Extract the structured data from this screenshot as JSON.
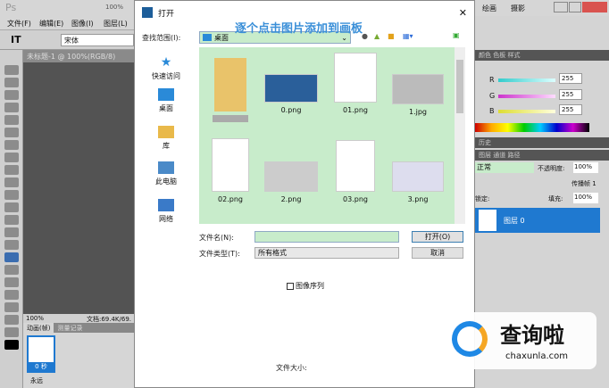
{
  "app": {
    "logo": "Ps",
    "zoom": "100%",
    "menus": [
      "文件(F)",
      "编辑(E)",
      "图像(I)",
      "图层(L)"
    ],
    "right_menus": [
      "绘画",
      "摄影"
    ],
    "font": "宋体",
    "doc_tab": "未标题-1 @ 100%(RGB/8)",
    "status_zoom": "100%",
    "status_doc": "文档:69.4K/69.",
    "anim_tabs": [
      "动画(帧)",
      "测量记录"
    ],
    "frame_time": "0 秒",
    "loop": "永远"
  },
  "dialog": {
    "title": "打开",
    "look_in_label": "查找范围(I):",
    "look_in_value": "桌面",
    "annotation": "逐个点击图片添加到画板",
    "sidebar": [
      {
        "label": "快速访问",
        "icon": "star-icon"
      },
      {
        "label": "桌面",
        "icon": "desktop-icon"
      },
      {
        "label": "库",
        "icon": "library-icon"
      },
      {
        "label": "此电脑",
        "icon": "computer-icon"
      },
      {
        "label": "网络",
        "icon": "network-icon"
      }
    ],
    "files": [
      {
        "name": ""
      },
      {
        "name": "0.png"
      },
      {
        "name": "01.png"
      },
      {
        "name": "1.jpg"
      },
      {
        "name": "02.png"
      },
      {
        "name": "2.png"
      },
      {
        "name": "03.png"
      },
      {
        "name": "3.png"
      }
    ],
    "filename_label": "文件名(N):",
    "filename_value": "",
    "filetype_label": "文件类型(T):",
    "filetype_value": "所有格式",
    "open": "打开(O)",
    "cancel": "取消",
    "sequence": "图像序列",
    "filesize": "文件大小:"
  },
  "panels": {
    "color_tabs": [
      "颜色",
      "色板",
      "样式"
    ],
    "r": "R",
    "g": "G",
    "b": "B",
    "r_val": "255",
    "g_val": "255",
    "b_val": "255",
    "hist_tab": "历史",
    "layer_tabs": [
      "图层",
      "通道",
      "路径"
    ],
    "blend": "正常",
    "opacity_label": "不透明度:",
    "opacity": "100%",
    "propagate": "传播帧 1",
    "lock": "锁定:",
    "fill_label": "填充:",
    "fill": "100%",
    "layer_name": "图层 0"
  },
  "watermark": {
    "brand": "查询啦",
    "url": "chaxunla.com"
  }
}
